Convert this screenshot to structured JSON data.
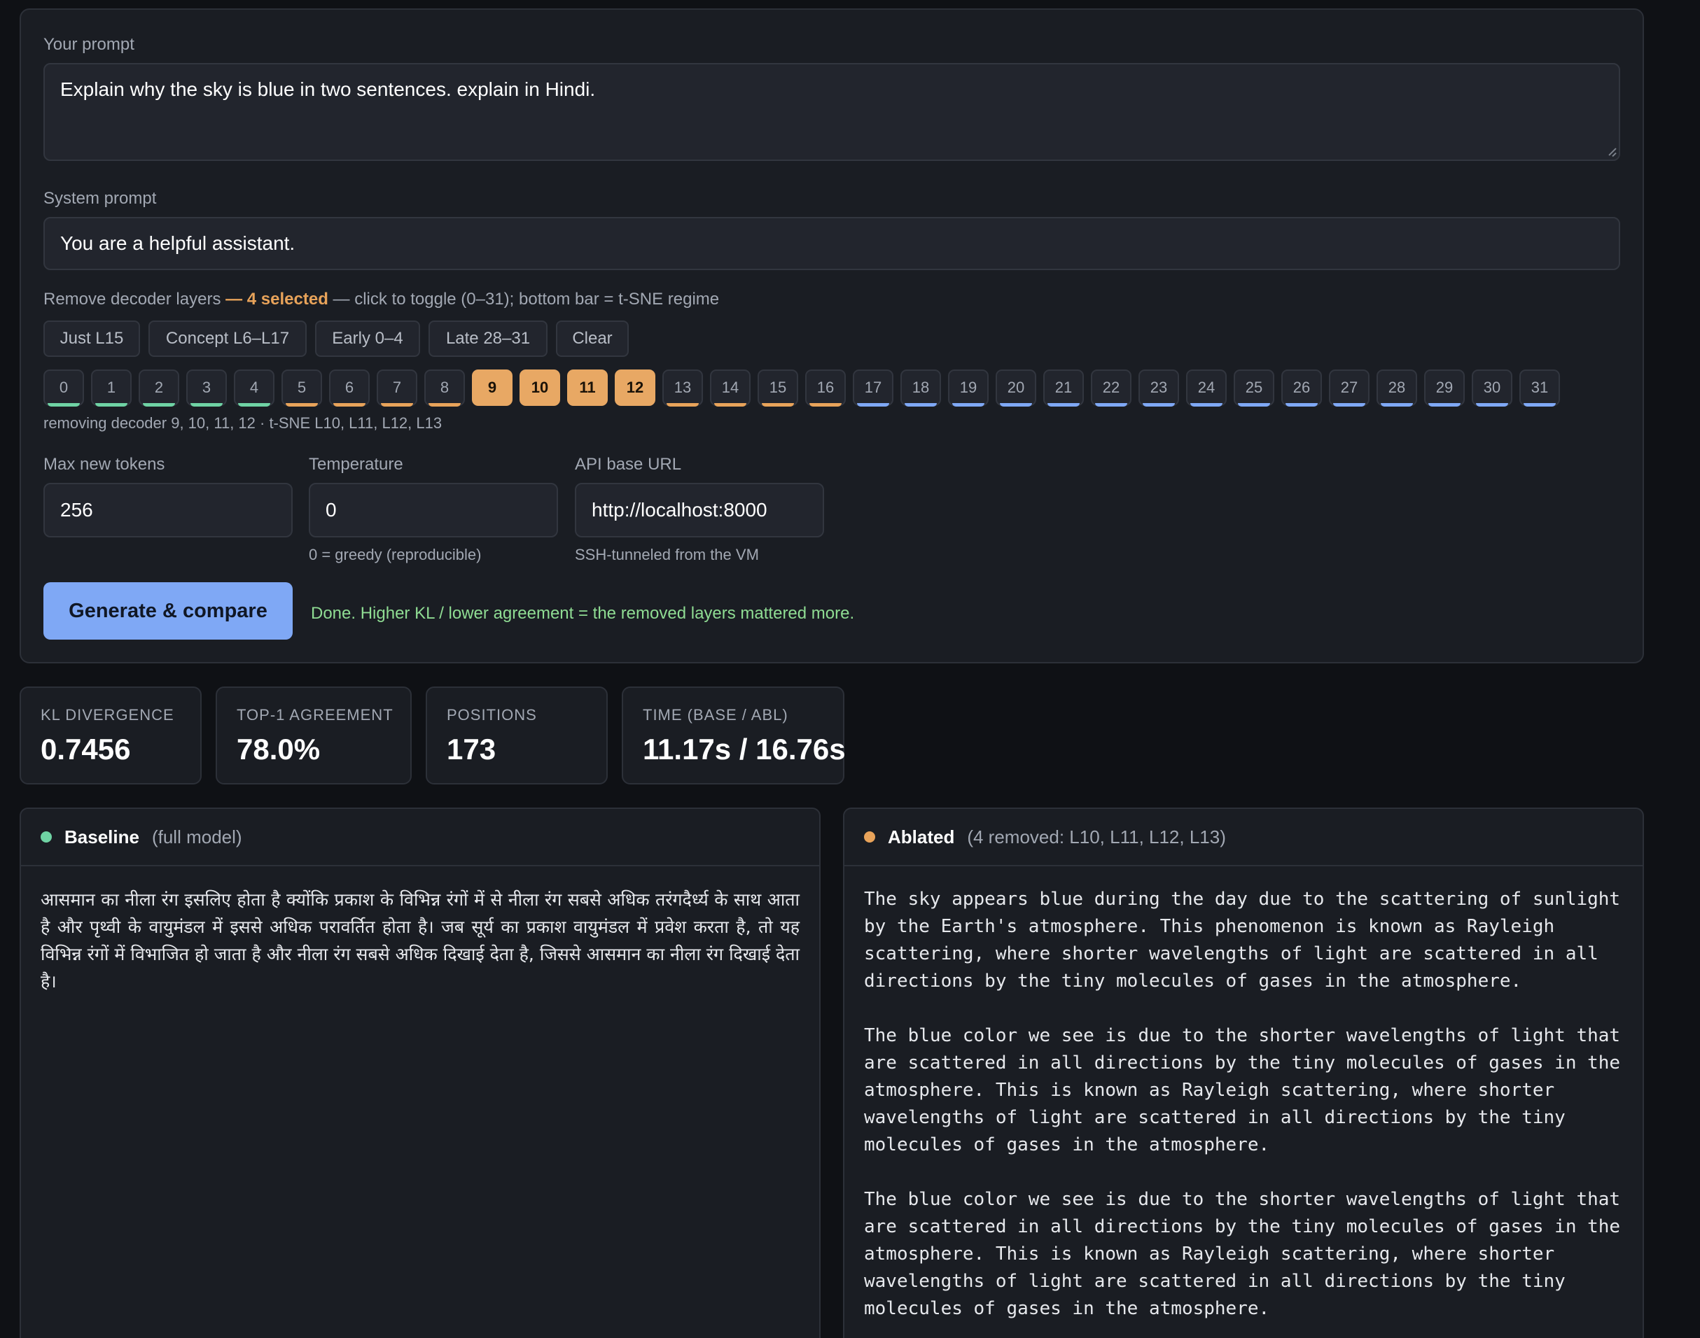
{
  "form": {
    "prompt_label": "Your prompt",
    "prompt_value": "Explain why the sky is blue in two sentences. explain in Hindi.",
    "system_label": "System prompt",
    "system_value": "You are a helpful assistant.",
    "layers_label_pre": "Remove decoder layers",
    "layers_selected": "— 4 selected",
    "layers_label_post": "— click to toggle (0–31); bottom bar = t-SNE regime",
    "presets": [
      "Just L15",
      "Concept L6–L17",
      "Early 0–4",
      "Late 28–31",
      "Clear"
    ],
    "layers": [
      {
        "label": "0",
        "regime": "green",
        "selected": false
      },
      {
        "label": "1",
        "regime": "green",
        "selected": false
      },
      {
        "label": "2",
        "regime": "green",
        "selected": false
      },
      {
        "label": "3",
        "regime": "green",
        "selected": false
      },
      {
        "label": "4",
        "regime": "green",
        "selected": false
      },
      {
        "label": "5",
        "regime": "orange",
        "selected": false
      },
      {
        "label": "6",
        "regime": "orange",
        "selected": false
      },
      {
        "label": "7",
        "regime": "orange",
        "selected": false
      },
      {
        "label": "8",
        "regime": "orange",
        "selected": false
      },
      {
        "label": "9",
        "regime": "orange",
        "selected": true
      },
      {
        "label": "10",
        "regime": "orange",
        "selected": true
      },
      {
        "label": "11",
        "regime": "orange",
        "selected": true
      },
      {
        "label": "12",
        "regime": "orange",
        "selected": true
      },
      {
        "label": "13",
        "regime": "orange",
        "selected": false
      },
      {
        "label": "14",
        "regime": "orange",
        "selected": false
      },
      {
        "label": "15",
        "regime": "orange",
        "selected": false
      },
      {
        "label": "16",
        "regime": "orange",
        "selected": false
      },
      {
        "label": "17",
        "regime": "blue",
        "selected": false
      },
      {
        "label": "18",
        "regime": "blue",
        "selected": false
      },
      {
        "label": "19",
        "regime": "blue",
        "selected": false
      },
      {
        "label": "20",
        "regime": "blue",
        "selected": false
      },
      {
        "label": "21",
        "regime": "blue",
        "selected": false
      },
      {
        "label": "22",
        "regime": "blue",
        "selected": false
      },
      {
        "label": "23",
        "regime": "blue",
        "selected": false
      },
      {
        "label": "24",
        "regime": "blue",
        "selected": false
      },
      {
        "label": "25",
        "regime": "blue",
        "selected": false
      },
      {
        "label": "26",
        "regime": "blue",
        "selected": false
      },
      {
        "label": "27",
        "regime": "blue",
        "selected": false
      },
      {
        "label": "28",
        "regime": "blue",
        "selected": false
      },
      {
        "label": "29",
        "regime": "blue",
        "selected": false
      },
      {
        "label": "30",
        "regime": "blue",
        "selected": false
      },
      {
        "label": "31",
        "regime": "blue",
        "selected": false
      }
    ],
    "regime_colors": {
      "green": "#6fd3a4",
      "orange": "#e8a35a",
      "blue": "#7fa8f5"
    },
    "removing_note": "removing decoder 9, 10, 11, 12 · t-SNE L10, L11, L12, L13",
    "max_tokens_label": "Max new tokens",
    "max_tokens_value": "256",
    "temperature_label": "Temperature",
    "temperature_value": "0",
    "temperature_hint": "0 = greedy (reproducible)",
    "api_label": "API base URL",
    "api_value": "http://localhost:8000",
    "api_hint": "SSH-tunneled from the VM",
    "generate_label": "Generate & compare",
    "status_text": "Done. Higher KL / lower agreement = the removed layers mattered more."
  },
  "stats": [
    {
      "key": "KL DIVERGENCE",
      "value": "0.7456"
    },
    {
      "key": "TOP-1 AGREEMENT",
      "value": "78.0%"
    },
    {
      "key": "POSITIONS",
      "value": "173"
    },
    {
      "key": "TIME (BASE / ABL)",
      "value": "11.17s / 16.76s"
    }
  ],
  "baseline": {
    "name": "Baseline",
    "sub": "(full model)",
    "dot_color": "#6fd3a4",
    "text": "आसमान का नीला रंग इसलिए होता है क्योंकि प्रकाश के विभिन्न रंगों में से नीला रंग सबसे अधिक तरंगदैर्ध्य के साथ आता है और पृथ्वी के वायुमंडल में इससे अधिक परावर्तित होता है। जब सूर्य का प्रकाश वायुमंडल में प्रवेश करता है, तो यह विभिन्न रंगों में विभाजित हो जाता है और नीला रंग सबसे अधिक दिखाई देता है, जिससे आसमान का नीला रंग दिखाई देता है।"
  },
  "ablated": {
    "name": "Ablated",
    "sub": "(4 removed: L10, L11, L12, L13)",
    "dot_color": "#e8a35a",
    "text": "The sky appears blue during the day due to the scattering of sunlight\nby the Earth's atmosphere. This phenomenon is known as Rayleigh\nscattering, where shorter wavelengths of light are scattered in all\ndirections by the tiny molecules of gases in the atmosphere.\n\nThe blue color we see is due to the shorter wavelengths of light that\nare scattered in all directions by the tiny molecules of gases in the\natmosphere. This is known as Rayleigh scattering, where shorter\nwavelengths of light are scattered in all directions by the tiny\nmolecules of gases in the atmosphere.\n\nThe blue color we see is due to the shorter wavelengths of light that\nare scattered in all directions by the tiny molecules of gases in the\natmosphere. This is known as Rayleigh scattering, where shorter\nwavelengths of light are scattered in all directions by the tiny\nmolecules of gases in the atmosphere."
  }
}
